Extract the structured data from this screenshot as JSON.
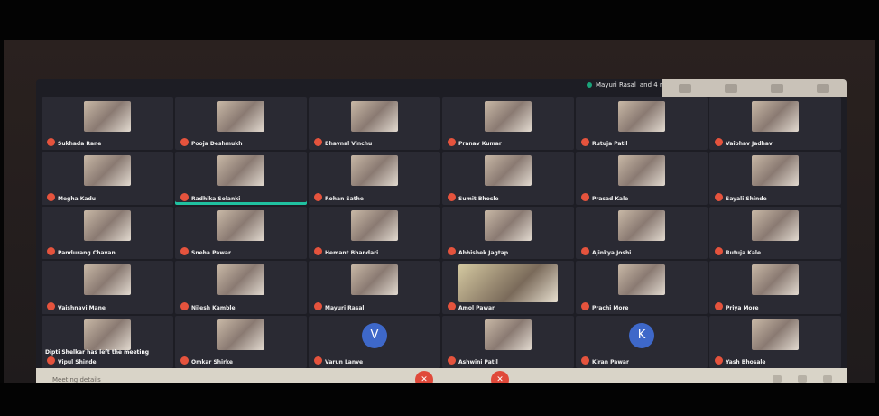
{
  "presenter": {
    "name": "Mayuri Rasal",
    "subtitle": "and 4 more"
  },
  "tiles": [
    {
      "name": "Sukhada Rane"
    },
    {
      "name": "Pooja Deshmukh"
    },
    {
      "name": "Bhavnal Vinchu"
    },
    {
      "name": "Pranav Kumar"
    },
    {
      "name": "Rutuja Patil"
    },
    {
      "name": "Vaibhav Jadhav"
    },
    {
      "name": "Megha Kadu"
    },
    {
      "name": "Radhika Solanki"
    },
    {
      "name": "Rohan Sathe"
    },
    {
      "name": "Sumit Bhosle"
    },
    {
      "name": "Prasad Kale"
    },
    {
      "name": "Sayali Shinde"
    },
    {
      "name": "Pandurang Chavan"
    },
    {
      "name": "Sneha Pawar"
    },
    {
      "name": "Hemant Bhandari"
    },
    {
      "name": "Abhishek Jagtap"
    },
    {
      "name": "Ajinkya Joshi"
    },
    {
      "name": "Rutuja Kale"
    },
    {
      "name": "Vaishnavi Mane"
    },
    {
      "name": "Nilesh Kamble"
    },
    {
      "name": "Mayuri Rasal"
    },
    {
      "name": "Amol Pawar"
    },
    {
      "name": "Prachi More"
    },
    {
      "name": "Priya More"
    },
    {
      "name": "Vipul Shinde"
    },
    {
      "name": "Omkar Shirke"
    },
    {
      "name": "Varun Lanve",
      "letter": "V"
    },
    {
      "name": "Ashwini Patil"
    },
    {
      "name": "Kiran Pawar",
      "letter": "K"
    },
    {
      "name": "Yash Bhosale"
    }
  ],
  "notice": "Dipti Shelkar has left the meeting",
  "bottom_bar": {
    "left_text": "Meeting details"
  },
  "controls": {
    "mic_icon": "mic-off-icon",
    "cam_icon": "cam-off-icon"
  },
  "colors": {
    "accent_speaking": "#20c1a0",
    "muted": "#e5533d",
    "avatar": "#3e68c9"
  }
}
